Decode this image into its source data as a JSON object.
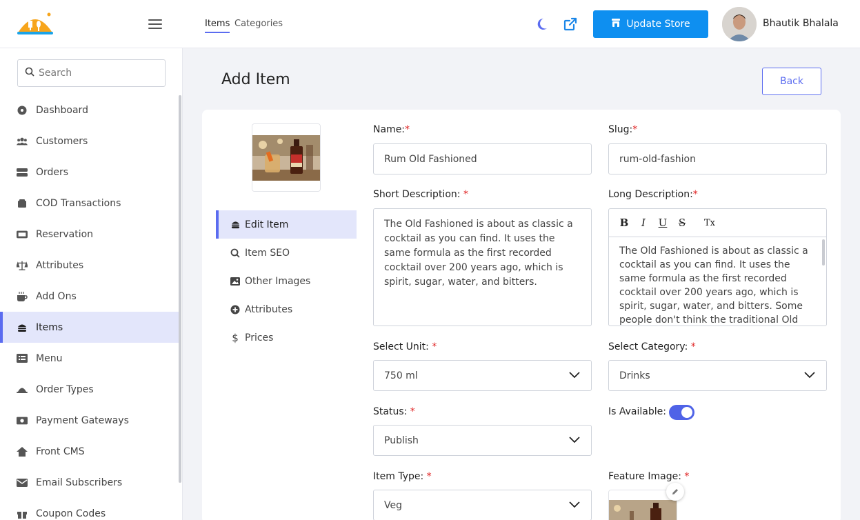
{
  "header": {
    "tabs": [
      {
        "label": "Items",
        "active": true
      },
      {
        "label": "Categories",
        "active": false
      }
    ],
    "update_store_label": "Update Store",
    "user_name": "Bhautik Bhalala",
    "accent_color": "#0e8ff0"
  },
  "sidebar": {
    "search_placeholder": "Search",
    "items": [
      {
        "label": "Dashboard",
        "icon": "dashboard-icon"
      },
      {
        "label": "Customers",
        "icon": "users-icon"
      },
      {
        "label": "Orders",
        "icon": "orders-icon"
      },
      {
        "label": "COD Transactions",
        "icon": "wallet-icon"
      },
      {
        "label": "Reservation",
        "icon": "ticket-icon"
      },
      {
        "label": "Attributes",
        "icon": "scale-icon"
      },
      {
        "label": "Add Ons",
        "icon": "mug-icon"
      },
      {
        "label": "Items",
        "icon": "burger-icon",
        "active": true
      },
      {
        "label": "Menu",
        "icon": "menu-list-icon"
      },
      {
        "label": "Order Types",
        "icon": "tray-icon"
      },
      {
        "label": "Payment Gateways",
        "icon": "money-icon"
      },
      {
        "label": "Front CMS",
        "icon": "home-icon"
      },
      {
        "label": "Email Subscribers",
        "icon": "envelope-icon"
      },
      {
        "label": "Coupon Codes",
        "icon": "gift-icon"
      }
    ]
  },
  "page": {
    "title": "Add Item",
    "back_label": "Back"
  },
  "submenu": [
    {
      "label": "Edit Item",
      "icon": "burger-icon",
      "active": true
    },
    {
      "label": "Item SEO",
      "icon": "search-icon"
    },
    {
      "label": "Other Images",
      "icon": "image-icon"
    },
    {
      "label": "Attributes",
      "icon": "plus-circle-icon"
    },
    {
      "label": "Prices",
      "icon": "dollar-icon"
    }
  ],
  "form": {
    "name": {
      "label": "Name:",
      "required": "*",
      "value": "Rum Old Fashioned"
    },
    "slug": {
      "label": "Slug:",
      "required": "*",
      "value": "rum-old-fashion"
    },
    "short_description": {
      "label": "Short Description:",
      "required": "*",
      "value": "The Old Fashioned is about as classic a cocktail as you can find. It uses the same formula as the first recorded cocktail over 200 years ago, which is spirit, sugar, water, and bitters."
    },
    "long_description": {
      "label": "Long Description:",
      "required": "*",
      "value": "The Old Fashioned is about as classic a cocktail as you can find. It uses the same formula as the first recorded cocktail over 200 years ago, which is spirit, sugar, water, and bitters. Some people don't think the traditional Old",
      "toolbar": [
        "B",
        "I",
        "U",
        "S",
        "Tx"
      ]
    },
    "unit": {
      "label": "Select Unit:",
      "required": "*",
      "value": "750 ml"
    },
    "category": {
      "label": "Select Category:",
      "required": "*",
      "value": "Drinks"
    },
    "status": {
      "label": "Status:",
      "required": "*",
      "value": "Publish"
    },
    "is_available": {
      "label": "Is Available:",
      "value": true
    },
    "item_type": {
      "label": "Item Type:",
      "required": "*",
      "value": "Veg"
    },
    "feature_image": {
      "label": "Feature Image:",
      "required": "*"
    }
  }
}
